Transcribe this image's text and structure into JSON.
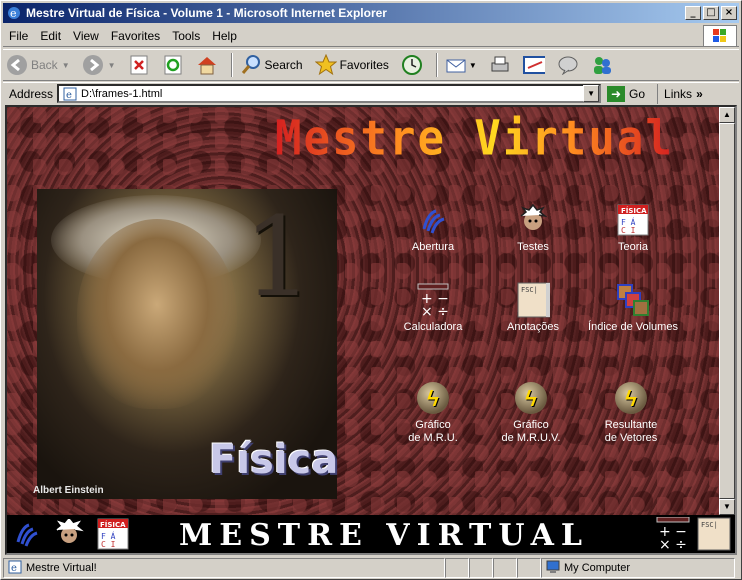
{
  "window": {
    "title": "Mestre Virtual de Física - Volume 1 - Microsoft Internet Explorer"
  },
  "menu": [
    "File",
    "Edit",
    "View",
    "Favorites",
    "Tools",
    "Help"
  ],
  "toolbar": {
    "back": "Back",
    "search": "Search",
    "favorites": "Favorites"
  },
  "address": {
    "label": "Address",
    "value": "D:\\frames-1.html",
    "go": "Go",
    "links": "Links"
  },
  "page": {
    "logo": "Mestre Virtual",
    "volume_number": "1",
    "cover_word": "Física",
    "photo_caption": "Albert Einstein",
    "items": [
      {
        "label": "Abertura"
      },
      {
        "label": "Testes"
      },
      {
        "label": "Teoria"
      },
      {
        "label": "Calculadora"
      },
      {
        "label": "Anotações"
      },
      {
        "label": "Índice de Volumes"
      },
      {
        "line1": "Gráfico",
        "line2": "de M.R.U."
      },
      {
        "line1": "Gráfico",
        "line2": "de M.R.U.V."
      },
      {
        "line1": "Resultante",
        "line2": "de Vetores"
      }
    ],
    "bottom_title": "MESTRE VIRTUAL"
  },
  "status": {
    "text": "Mestre Virtual!",
    "zone": "My Computer"
  },
  "colors": {
    "title_bar": "#0a246a",
    "page_background": "#5e2626",
    "logo_yellow": "#ffd820",
    "logo_red": "#d42020"
  }
}
